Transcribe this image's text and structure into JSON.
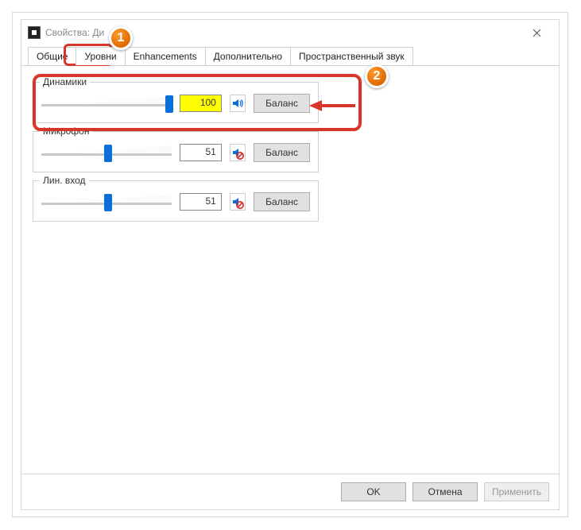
{
  "window": {
    "title": "Свойства: Ди"
  },
  "tabs": {
    "general": "Общие",
    "levels": "Уровни",
    "enhancements": "Enhancements",
    "advanced": "Дополнительно",
    "spatial": "Пространственный звук"
  },
  "groups": {
    "speakers": {
      "label": "Динамики",
      "value": "100",
      "slider_percent": 100,
      "balance": "Баланс",
      "muted": false
    },
    "microphone": {
      "label": "Микрофон",
      "value": "51",
      "slider_percent": 51,
      "balance": "Баланс",
      "muted": true
    },
    "linein": {
      "label": "Лин. вход",
      "value": "51",
      "slider_percent": 51,
      "balance": "Баланс",
      "muted": true
    }
  },
  "footer": {
    "ok": "OK",
    "cancel": "Отмена",
    "apply": "Применить"
  },
  "callouts": {
    "one": "1",
    "two": "2"
  },
  "colors": {
    "highlight": "#d9362b",
    "accent": "#0a6fd8",
    "value_hl": "#ffff00"
  }
}
